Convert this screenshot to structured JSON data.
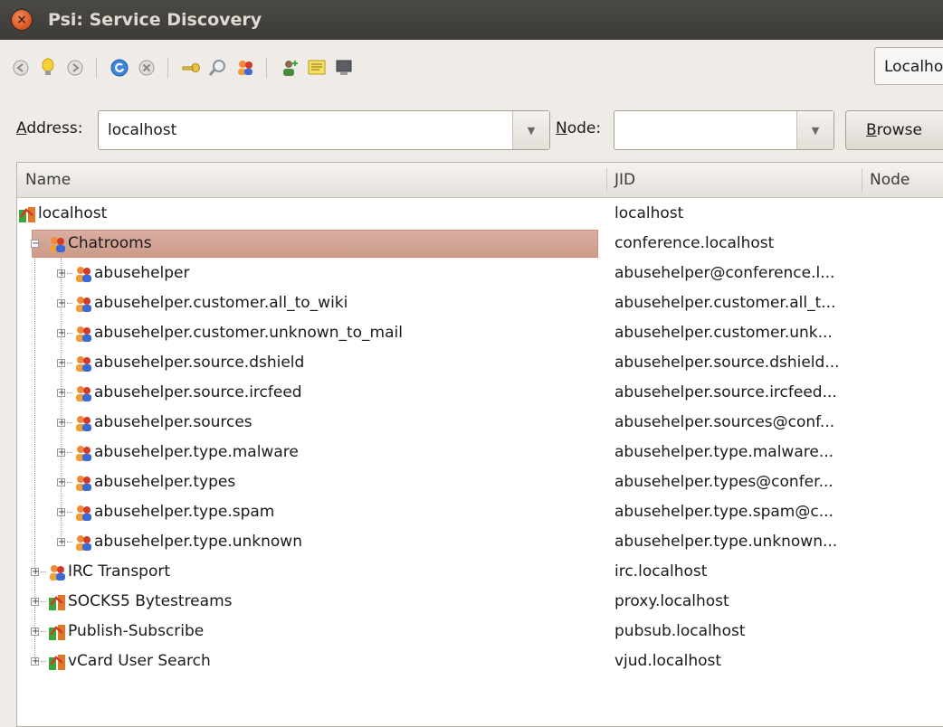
{
  "window": {
    "title": "Psi: Service Discovery"
  },
  "toolbar": {
    "icons": [
      "back-icon",
      "lightbulb-icon",
      "forward-icon",
      "refresh-icon",
      "stop-icon",
      "key-icon",
      "search-icon",
      "groupchat-icon",
      "add-contact-icon",
      "vcard-icon",
      "terminal-icon"
    ],
    "account_value": "Localhost"
  },
  "address": {
    "label_prefix": "A",
    "label_rest": "ddress:",
    "value": "localhost",
    "node_label_prefix": "N",
    "node_label_rest": "ode:",
    "node_value": "",
    "browse_prefix": "B",
    "browse_rest": "rowse"
  },
  "tree": {
    "columns": [
      "Name",
      "JID",
      "Node"
    ],
    "rows": [
      {
        "name": "localhost",
        "jid": "localhost",
        "icon": "server-icon"
      },
      {
        "name": "Chatrooms",
        "jid": "conference.localhost",
        "icon": "groupchat-icon"
      },
      {
        "name": "abusehelper",
        "jid": "abusehelper@conference.l...",
        "icon": "groupchat-icon"
      },
      {
        "name": "abusehelper.customer.all_to_wiki",
        "jid": "abusehelper.customer.all_t...",
        "icon": "groupchat-icon"
      },
      {
        "name": "abusehelper.customer.unknown_to_mail",
        "jid": "abusehelper.customer.unk...",
        "icon": "groupchat-icon"
      },
      {
        "name": "abusehelper.source.dshield",
        "jid": "abusehelper.source.dshield...",
        "icon": "groupchat-icon"
      },
      {
        "name": "abusehelper.source.ircfeed",
        "jid": "abusehelper.source.ircfeed...",
        "icon": "groupchat-icon"
      },
      {
        "name": "abusehelper.sources",
        "jid": "abusehelper.sources@conf...",
        "icon": "groupchat-icon"
      },
      {
        "name": "abusehelper.type.malware",
        "jid": "abusehelper.type.malware...",
        "icon": "groupchat-icon"
      },
      {
        "name": "abusehelper.types",
        "jid": "abusehelper.types@confer...",
        "icon": "groupchat-icon"
      },
      {
        "name": "abusehelper.type.spam",
        "jid": "abusehelper.type.spam@c...",
        "icon": "groupchat-icon"
      },
      {
        "name": "abusehelper.type.unknown",
        "jid": "abusehelper.type.unknown...",
        "icon": "groupchat-icon"
      },
      {
        "name": "IRC Transport",
        "jid": "irc.localhost",
        "icon": "groupchat-icon"
      },
      {
        "name": "SOCKS5 Bytestreams",
        "jid": "proxy.localhost",
        "icon": "server-icon"
      },
      {
        "name": "Publish-Subscribe",
        "jid": "pubsub.localhost",
        "icon": "server-icon"
      },
      {
        "name": "vCard User Search",
        "jid": "vjud.localhost",
        "icon": "server-icon"
      }
    ]
  }
}
